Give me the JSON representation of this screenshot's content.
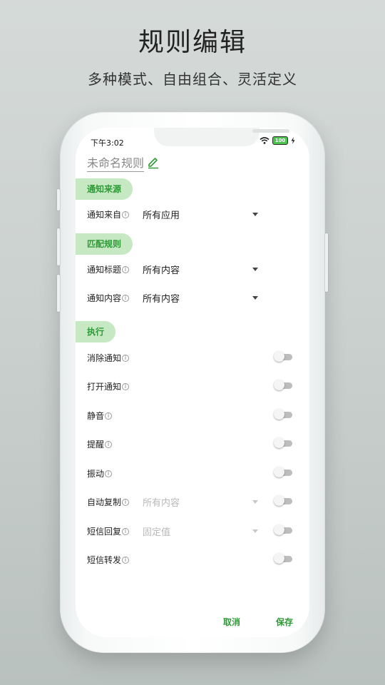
{
  "promo": {
    "title": "规则编辑",
    "subtitle": "多种模式、自由组合、灵活定义"
  },
  "status_bar": {
    "time": "下午3:02",
    "battery": "100"
  },
  "rule": {
    "name": "未命名规则"
  },
  "sections": {
    "source": {
      "title": "通知来源",
      "rows": [
        {
          "label": "通知来自",
          "value": "所有应用"
        }
      ]
    },
    "match": {
      "title": "匹配规则",
      "rows": [
        {
          "label": "通知标题",
          "value": "所有内容"
        },
        {
          "label": "通知内容",
          "value": "所有内容"
        }
      ]
    },
    "execute": {
      "title": "执行",
      "rows": [
        {
          "label": "消除通知",
          "enabled": false
        },
        {
          "label": "打开通知",
          "enabled": false
        },
        {
          "label": "静音",
          "enabled": false
        },
        {
          "label": "提醒",
          "enabled": false
        },
        {
          "label": "振动",
          "enabled": false
        },
        {
          "label": "自动复制",
          "value": "所有内容",
          "enabled": false
        },
        {
          "label": "短信回复",
          "value": "固定值",
          "enabled": false
        },
        {
          "label": "短信转发",
          "enabled": false
        }
      ]
    }
  },
  "footer": {
    "cancel": "取消",
    "save": "保存"
  },
  "colors": {
    "accent": "#2f9a37",
    "chip_bg": "#c6e9c4"
  },
  "icons": {
    "info": "info-icon",
    "edit": "pencil-icon",
    "dropdown": "caret-down-icon"
  }
}
